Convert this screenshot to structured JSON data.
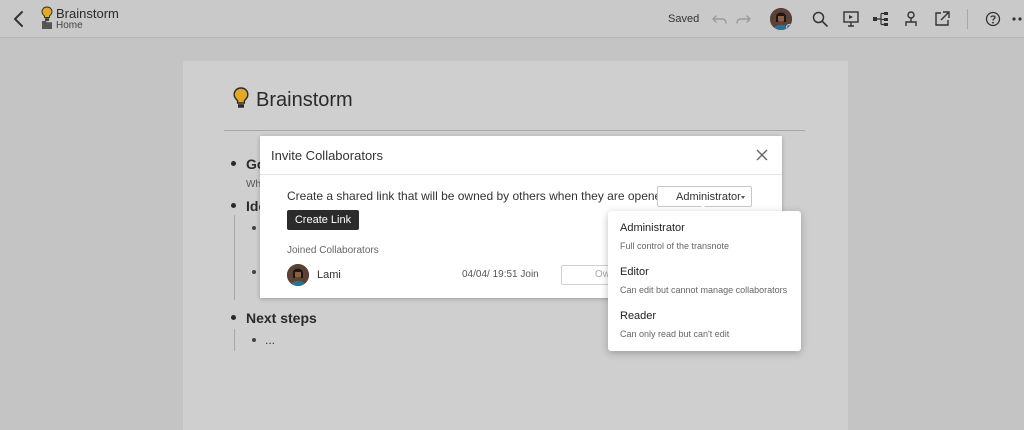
{
  "topbar": {
    "title": "Brainstorm",
    "folder": "Home",
    "status": "Saved"
  },
  "document": {
    "title": "Brainstorm",
    "bullets": {
      "goals_partial": "Go",
      "goals_sub_partial": "Wh",
      "ideas_partial": "Ide",
      "next_steps": "Next steps",
      "next_steps_child": "..."
    }
  },
  "modal": {
    "title": "Invite Collaborators",
    "share_text": "Create a shared link that will be owned by others when they are opened:",
    "selected_role": "Administrator",
    "create_link_label": "Create Link",
    "joined_label": "Joined Collaborators",
    "collaborators": [
      {
        "name": "Lami",
        "time": "04/04/ 19:51 Join",
        "role_partial": "Ow"
      }
    ]
  },
  "role_menu": {
    "options": [
      {
        "name": "Administrator",
        "description": "Full control of the transnote"
      },
      {
        "name": "Editor",
        "description": "Can edit but cannot manage collaborators"
      },
      {
        "name": "Reader",
        "description": "Can only read but can't edit"
      }
    ]
  },
  "colors": {
    "overlay_background": "#c4c4c4",
    "primary_button": "#2b2b2b",
    "bulb_accent": "#e0a92a",
    "avatar_badge": "#3d6fd1"
  }
}
